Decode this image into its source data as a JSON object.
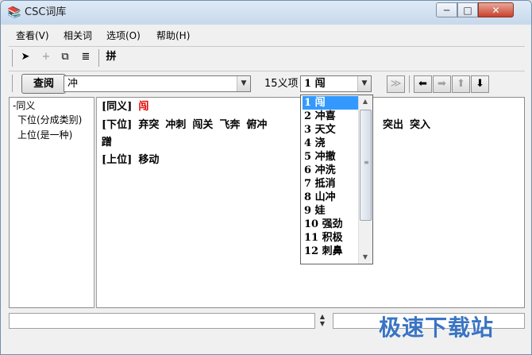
{
  "window": {
    "title": "CSC词库",
    "minimize": "─",
    "maximize": "□",
    "close": "✕",
    "icon": "books-icon"
  },
  "menu": [
    {
      "label": "查看(V)"
    },
    {
      "label": "相关词"
    },
    {
      "label": "选项(O)"
    },
    {
      "label": "帮助(H)"
    }
  ],
  "toolbar1": {
    "pointer": "➤",
    "add": "+",
    "copy": "⧉",
    "list": "≣",
    "pinyin": "拼"
  },
  "search": {
    "button": "查阅",
    "term": "冲",
    "count_label": "15义项",
    "sense_value": "1 闯",
    "nav": {
      "next_page": "≫",
      "back": "⬅",
      "forward": "➡",
      "up": "⬆",
      "down": "⬇"
    }
  },
  "tree": [
    "-同义",
    "下位(分成类别)",
    "上位(是一种)"
  ],
  "content": {
    "synonym_tag": "[同义]",
    "synonym_word": "闯",
    "hyponym_tag": "[下位]",
    "hyponym_words": [
      "弃突",
      "冲刺",
      "闯关",
      "飞奔",
      "俯冲"
    ],
    "hyponym_tail_words": [
      "突出",
      "突入"
    ],
    "hyponym_wrap": "蹭",
    "hypernym_tag": "[上位]",
    "hypernym_words": [
      "移动"
    ]
  },
  "dropdown_items": [
    "1 闯",
    "2 冲喜",
    "3 天文",
    "4 浇",
    "5 冲撤",
    "6 冲洗",
    "7 抵消",
    "8 山冲",
    "9 娃",
    "10 强劲",
    "11 积极",
    "12 刺鼻"
  ],
  "watermark": "极速下载站"
}
